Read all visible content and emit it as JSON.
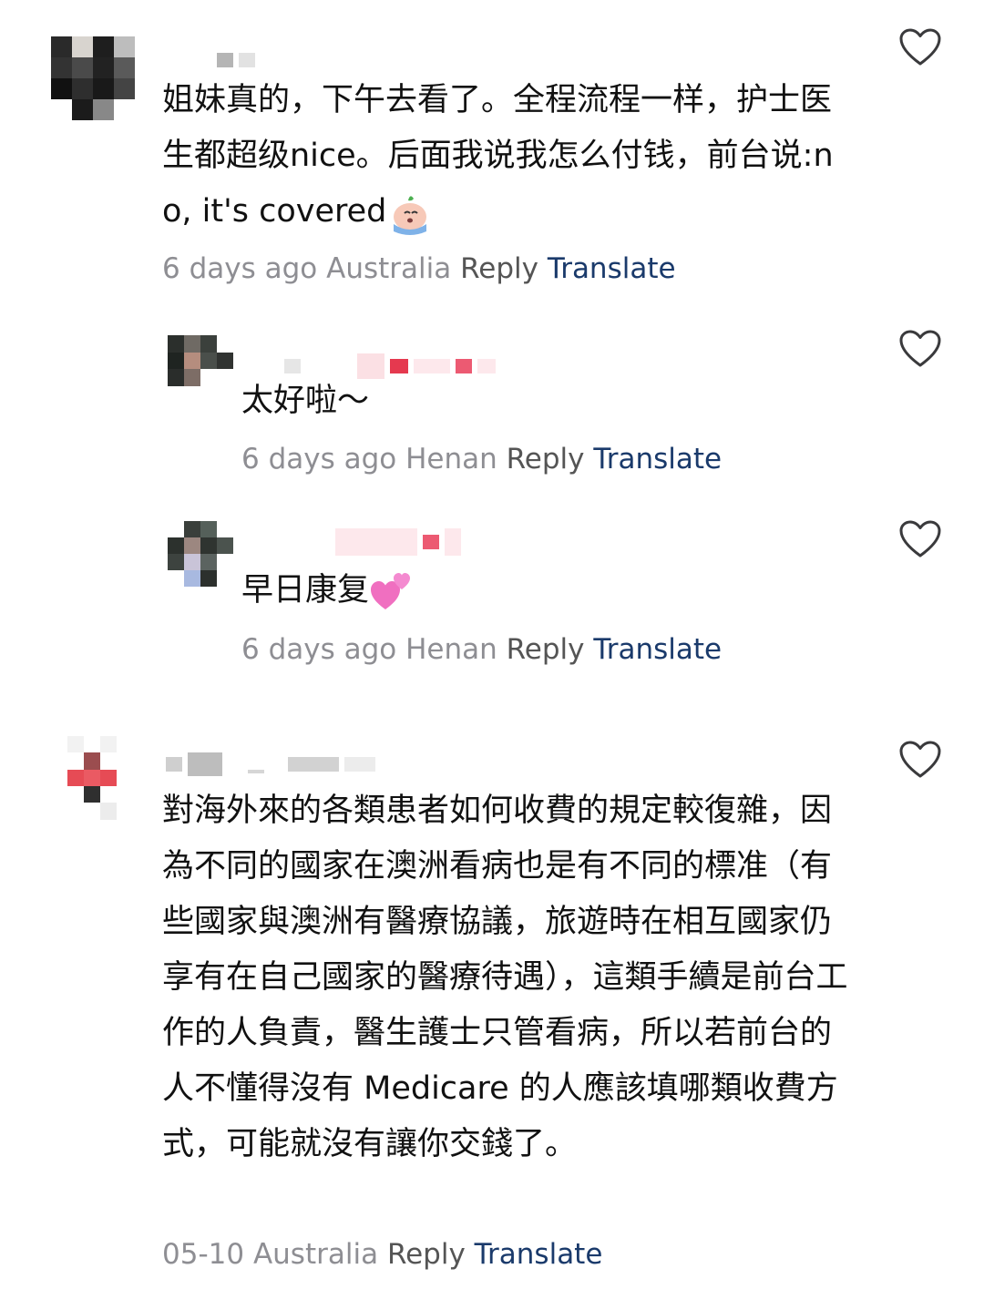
{
  "comments": [
    {
      "text": "姐妹真的，下午去看了。全程流程一样，护士医生都超级nice。后面我说我怎么付钱，前台说:no, it's covered",
      "emoji": "crying-emoji",
      "time": "6 days ago",
      "location": "Australia",
      "reply_label": "Reply",
      "translate_label": "Translate"
    },
    {
      "text": "太好啦～",
      "time": "6 days ago",
      "location": "Henan",
      "reply_label": "Reply",
      "translate_label": "Translate"
    },
    {
      "text": "早日康复",
      "emoji": "two-hearts-emoji",
      "time": "6 days ago",
      "location": "Henan",
      "reply_label": "Reply",
      "translate_label": "Translate"
    },
    {
      "text": "對海外來的各類患者如何收費的規定較復雜，因為不同的國家在澳洲看病也是有不同的標准（有些國家與澳洲有醫療協議，旅遊時在相互國家仍享有在自己國家的醫療待遇），這類手續是前台工作的人負責，醫生護士只管看病，所以若前台的人不懂得沒有 Medicare 的人應該填哪類收費方式，可能就沒有讓你交錢了。",
      "time": "05-10",
      "location": "Australia",
      "reply_label": "Reply",
      "translate_label": "Translate"
    }
  ],
  "colors": {
    "meta": "#8e8e93",
    "translate": "#1a3a6b",
    "text": "#111111",
    "heart": "#3a3a3c"
  },
  "icons": {
    "like": "heart-outline-icon"
  }
}
